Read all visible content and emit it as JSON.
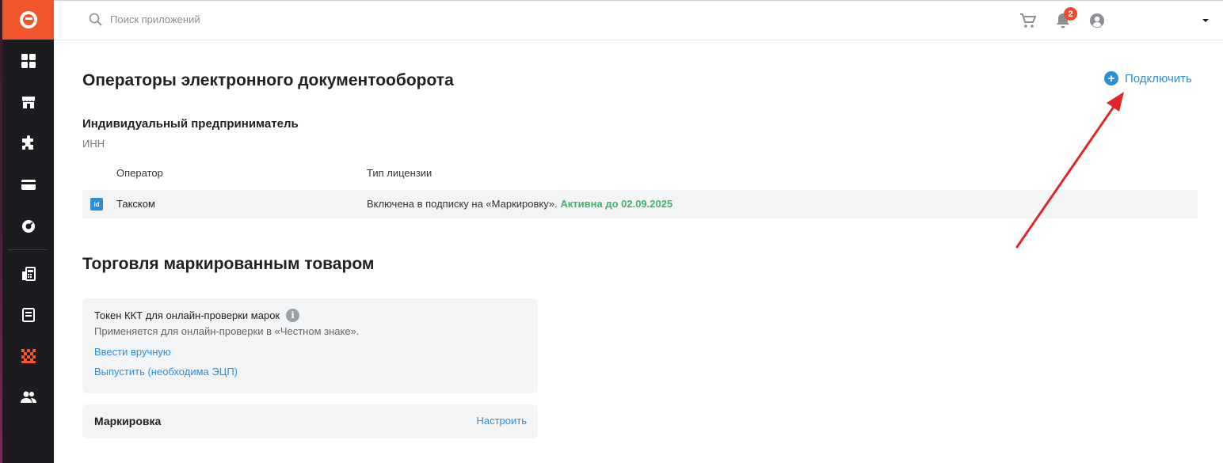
{
  "search": {
    "placeholder": "Поиск приложений"
  },
  "notifications": {
    "count": "2"
  },
  "edo": {
    "title": "Операторы электронного документооборота",
    "connect_label": "Подключить",
    "org_name": "Индивидуальный предприниматель",
    "inn_label": "ИНН",
    "columns": {
      "operator": "Оператор",
      "license": "Тип лицензии"
    },
    "rows": [
      {
        "operator_icon": "id",
        "operator": "Такском",
        "license": "Включена в подписку на «Маркировку».",
        "status": "Активна до 02.09.2025"
      }
    ]
  },
  "marking": {
    "title": "Торговля маркированным товаром",
    "token_card": {
      "title": "Токен ККТ для онлайн-проверки марок",
      "info_glyph": "i",
      "description": "Применяется для онлайн-проверки в «Честном знаке».",
      "link_manual": "Ввести вручную",
      "link_issue": "Выпустить (необходима ЭЦП)"
    },
    "settings_card": {
      "name": "Маркировка",
      "configure": "Настроить"
    }
  },
  "colors": {
    "brand": "#f0552b",
    "sidebar": "#1c1b20",
    "link": "#2c8fd6",
    "active": "#3fb46b",
    "annotation": "#e0262b"
  }
}
